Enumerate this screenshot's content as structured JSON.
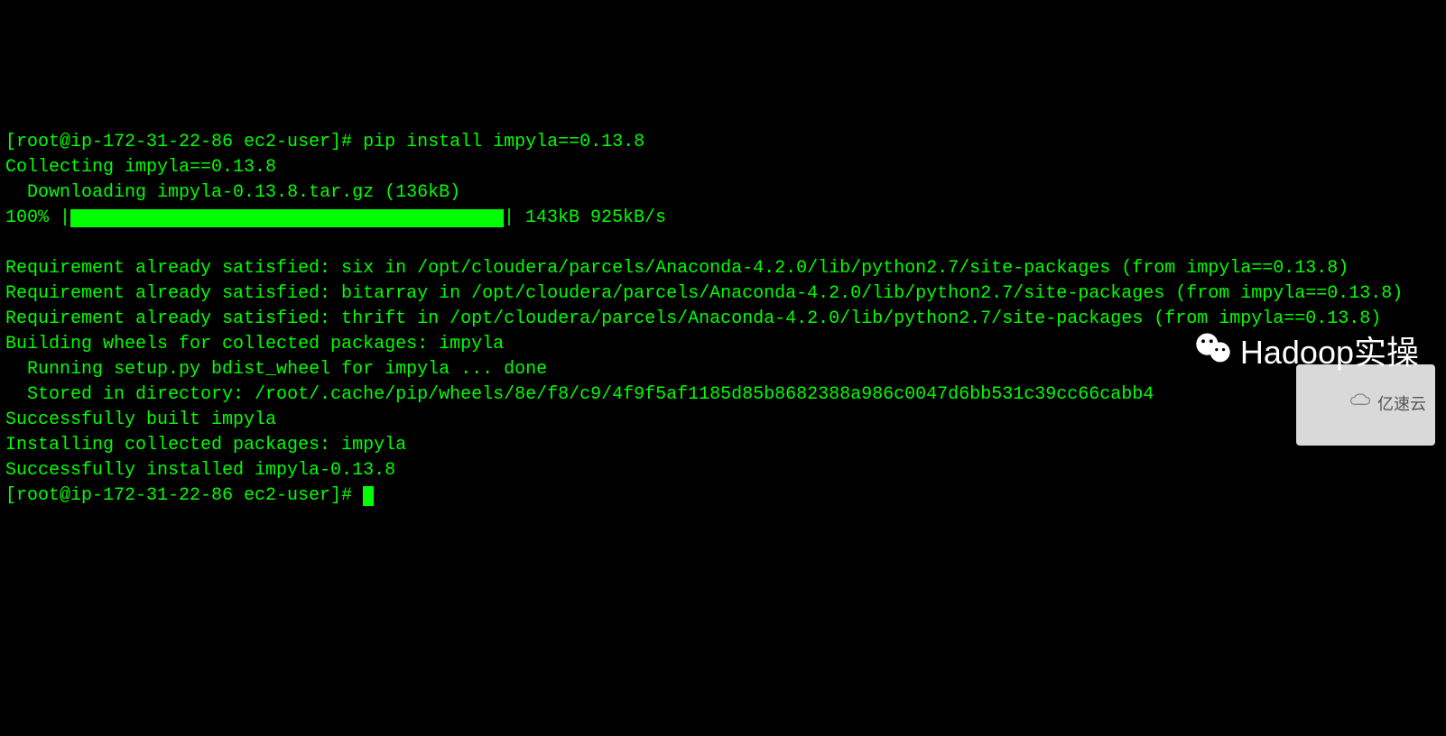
{
  "terminal": {
    "prompt": "[root@ip-172-31-22-86 ec2-user]#",
    "command": "pip install impyla==0.13.8",
    "lines": {
      "collecting": "Collecting impyla==0.13.8",
      "downloading": "  Downloading impyla-0.13.8.tar.gz (136kB)",
      "progress_percent": "    100% |",
      "progress_stats": "| 143kB 925kB/s",
      "req_six": "Requirement already satisfied: six in /opt/cloudera/parcels/Anaconda-4.2.0/lib/python2.7/site-packages (from impyla==0.13.8)",
      "req_bitarray": "Requirement already satisfied: bitarray in /opt/cloudera/parcels/Anaconda-4.2.0/lib/python2.7/site-packages (from impyla==0.13.8)",
      "req_thrift": "Requirement already satisfied: thrift in /opt/cloudera/parcels/Anaconda-4.2.0/lib/python2.7/site-packages (from impyla==0.13.8)",
      "building": "Building wheels for collected packages: impyla",
      "running": "  Running setup.py bdist_wheel for impyla ... done",
      "stored": "  Stored in directory: /root/.cache/pip/wheels/8e/f8/c9/4f9f5af1185d85b8682388a986c0047d6bb531c39cc66cabb4",
      "built": "Successfully built impyla",
      "installing": "Installing collected packages: impyla",
      "installed": "Successfully installed impyla-0.13.8"
    }
  },
  "watermarks": {
    "top": "Hadoop实操",
    "bottom": "亿速云"
  }
}
